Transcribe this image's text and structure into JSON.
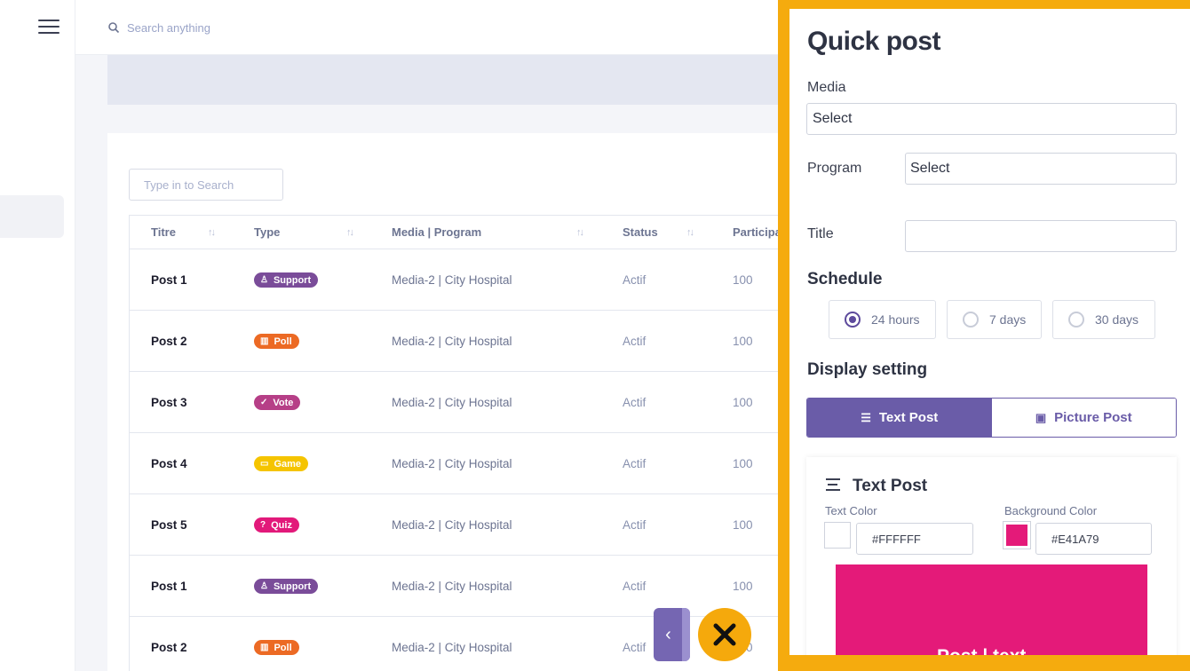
{
  "topbar": {
    "search_placeholder": "Search anything"
  },
  "table": {
    "search_placeholder": "Type in to Search",
    "columns": [
      "Titre",
      "Type",
      "Media | Program",
      "Status",
      "Participa"
    ],
    "rows": [
      {
        "title": "Post 1",
        "type": "Support",
        "type_icon": "person-icon",
        "media": "Media-2 | City Hospital",
        "status": "Actif",
        "participants": "100"
      },
      {
        "title": "Post 2",
        "type": "Poll",
        "type_icon": "bar-chart-icon",
        "media": "Media-2 | City Hospital",
        "status": "Actif",
        "participants": "100"
      },
      {
        "title": "Post 3",
        "type": "Vote",
        "type_icon": "check-icon",
        "media": "Media-2 | City Hospital",
        "status": "Actif",
        "participants": "100"
      },
      {
        "title": "Post 4",
        "type": "Game",
        "type_icon": "gamepad-icon",
        "media": "Media-2 | City Hospital",
        "status": "Actif",
        "participants": "100"
      },
      {
        "title": "Post 5",
        "type": "Quiz",
        "type_icon": "question-icon",
        "media": "Media-2 | City Hospital",
        "status": "Actif",
        "participants": "100"
      },
      {
        "title": "Post 1",
        "type": "Support",
        "type_icon": "person-icon",
        "media": "Media-2 | City Hospital",
        "status": "Actif",
        "participants": "100"
      },
      {
        "title": "Post 2",
        "type": "Poll",
        "type_icon": "bar-chart-icon",
        "media": "Media-2 | City Hospital",
        "status": "Actif",
        "participants": "100"
      }
    ]
  },
  "quick_post": {
    "title": "Quick post",
    "media_label": "Media",
    "media_value": "Select",
    "program_label": "Program",
    "program_value": "Select",
    "title_label": "Title",
    "title_value": "",
    "schedule_heading": "Schedule",
    "schedule_options": [
      {
        "label": "24 hours",
        "selected": true
      },
      {
        "label": "7 days",
        "selected": false
      },
      {
        "label": "30 days",
        "selected": false
      }
    ],
    "display_heading": "Display setting",
    "tabs": [
      {
        "label": "Text Post",
        "active": true,
        "icon": "text-lines-icon"
      },
      {
        "label": "Picture Post",
        "active": false,
        "icon": "image-icon"
      }
    ],
    "text_post": {
      "heading": "Text Post",
      "text_color_label": "Text Color",
      "text_color_value": "#FFFFFF",
      "bg_color_label": "Background Color",
      "bg_color_value": "#E41A79",
      "preview_text": "Post |  text"
    }
  },
  "colors": {
    "accent": "#6a5ca8",
    "panel_frame": "#f5ab0e",
    "preview_bg": "#E41A79"
  }
}
